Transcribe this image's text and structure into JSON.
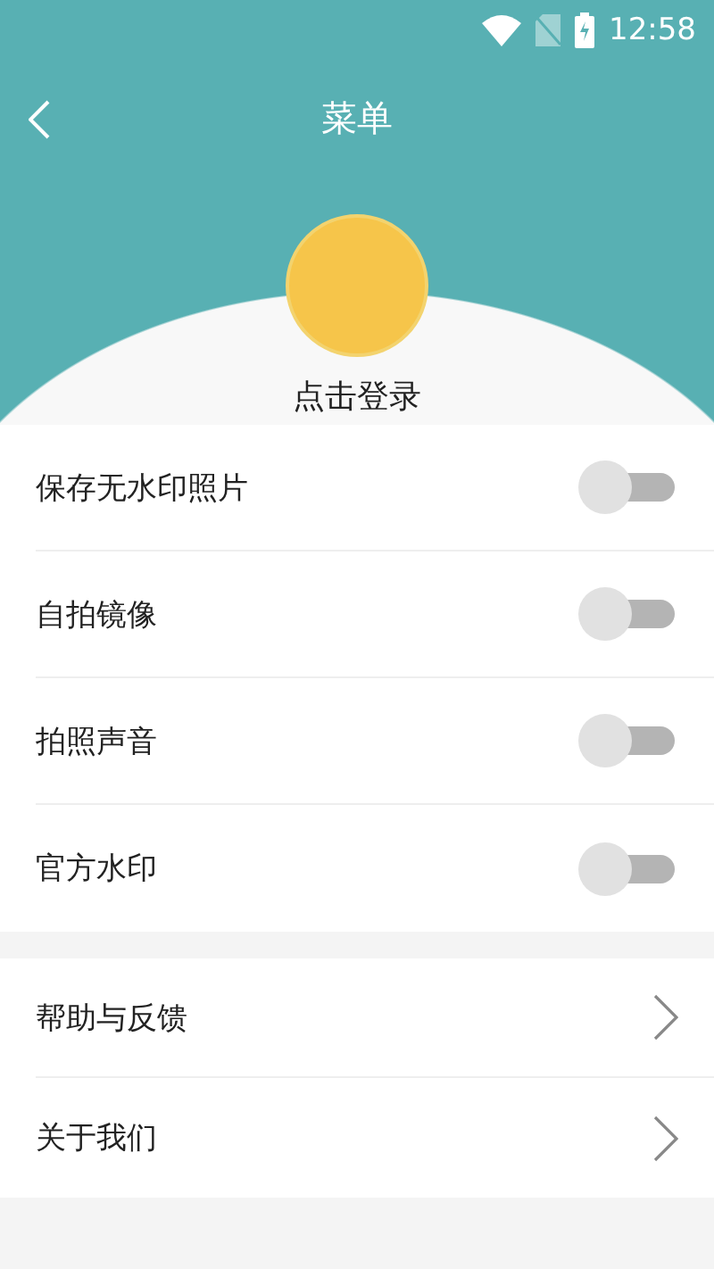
{
  "status_bar": {
    "time": "12:58"
  },
  "header": {
    "title": "菜单"
  },
  "profile": {
    "login_label": "点击登录"
  },
  "settings": [
    {
      "label": "保存无水印照片",
      "on": false
    },
    {
      "label": "自拍镜像",
      "on": false
    },
    {
      "label": "拍照声音",
      "on": false
    },
    {
      "label": "官方水印",
      "on": false
    }
  ],
  "links": [
    {
      "label": "帮助与反馈"
    },
    {
      "label": "关于我们"
    }
  ]
}
